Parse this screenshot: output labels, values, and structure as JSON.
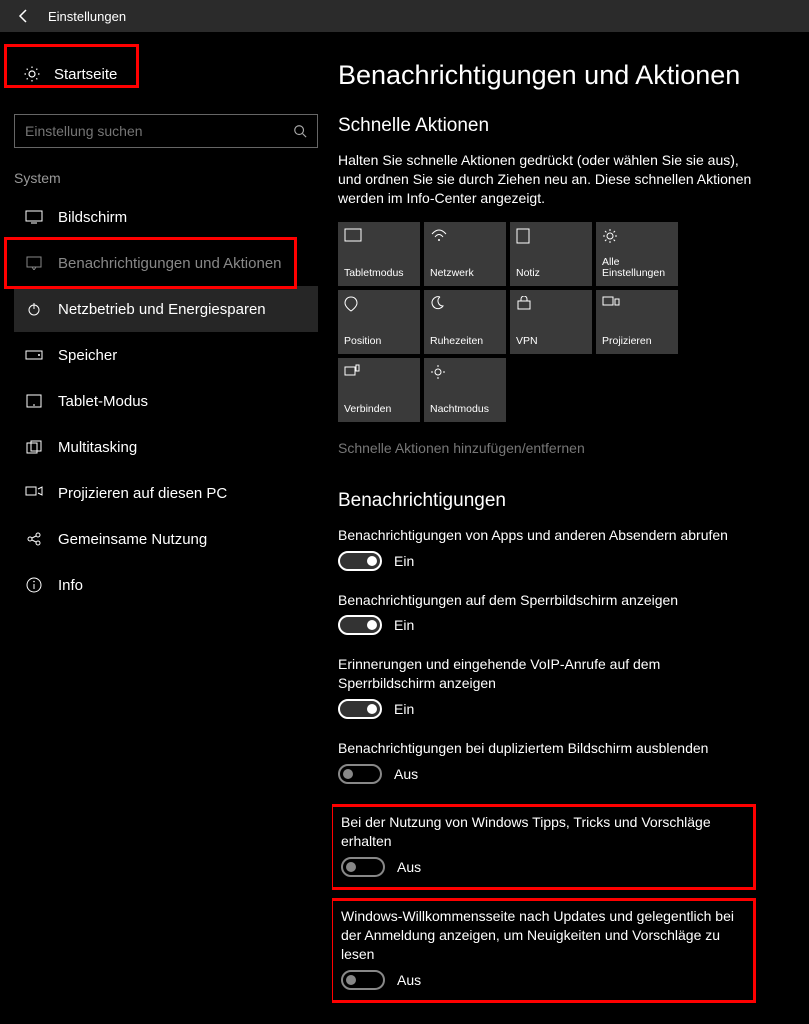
{
  "window": {
    "title": "Einstellungen"
  },
  "sidebar": {
    "home": "Startseite",
    "search_placeholder": "Einstellung suchen",
    "section": "System",
    "items": [
      {
        "label": "Bildschirm"
      },
      {
        "label": "Benachrichtigungen und Aktionen"
      },
      {
        "label": "Netzbetrieb und Energiesparen"
      },
      {
        "label": "Speicher"
      },
      {
        "label": "Tablet-Modus"
      },
      {
        "label": "Multitasking"
      },
      {
        "label": "Projizieren auf diesen PC"
      },
      {
        "label": "Gemeinsame Nutzung"
      },
      {
        "label": "Info"
      }
    ]
  },
  "main": {
    "title": "Benachrichtigungen und Aktionen",
    "quick_actions": {
      "heading": "Schnelle Aktionen",
      "desc": "Halten Sie schnelle Aktionen gedrückt (oder wählen Sie sie aus), und ordnen Sie sie durch Ziehen neu an. Diese schnellen Aktionen werden im Info-Center angezeigt.",
      "tiles": [
        "Tabletmodus",
        "Netzwerk",
        "Notiz",
        "Alle Einstellungen",
        "Position",
        "Ruhezeiten",
        "VPN",
        "Projizieren",
        "Verbinden",
        "Nachtmodus"
      ],
      "edit_link": "Schnelle Aktionen hinzufügen/entfernen"
    },
    "notifications": {
      "heading": "Benachrichtigungen",
      "settings": [
        {
          "label": "Benachrichtigungen von Apps und anderen Absendern abrufen",
          "state": "Ein",
          "on": true
        },
        {
          "label": "Benachrichtigungen auf dem Sperrbildschirm anzeigen",
          "state": "Ein",
          "on": true
        },
        {
          "label": "Erinnerungen und eingehende VoIP-Anrufe auf dem Sperrbildschirm anzeigen",
          "state": "Ein",
          "on": true
        },
        {
          "label": "Benachrichtigungen bei dupliziertem Bildschirm ausblenden",
          "state": "Aus",
          "on": false
        },
        {
          "label": "Bei der Nutzung von Windows Tipps, Tricks und Vorschläge erhalten",
          "state": "Aus",
          "on": false
        },
        {
          "label": "Windows-Willkommensseite nach Updates und gelegentlich bei der Anmeldung anzeigen, um Neuigkeiten und Vorschläge zu lesen",
          "state": "Aus",
          "on": false
        }
      ]
    }
  }
}
